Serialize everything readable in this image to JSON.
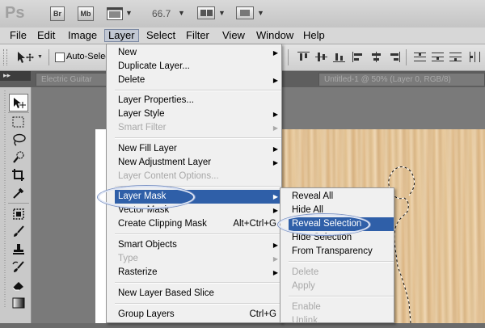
{
  "app": {
    "logo": "Ps",
    "bridge_label": "Br",
    "minibridge_label": "Mb",
    "zoom": "66.7"
  },
  "menubar": {
    "items": [
      {
        "label": "File"
      },
      {
        "label": "Edit"
      },
      {
        "label": "Image"
      },
      {
        "label": "Layer"
      },
      {
        "label": "Select"
      },
      {
        "label": "Filter"
      },
      {
        "label": "View"
      },
      {
        "label": "Window"
      },
      {
        "label": "Help"
      }
    ]
  },
  "options": {
    "auto_select_label": "Auto-Selec"
  },
  "tabs": {
    "left_tab": "Electric Guitar",
    "right_tab": "Untitled-1 @ 50% (Layer 0, RGB/8)"
  },
  "layer_menu": {
    "new": "New",
    "duplicate": "Duplicate Layer...",
    "delete": "Delete",
    "properties": "Layer Properties...",
    "style": "Layer Style",
    "smart_filter": "Smart Filter",
    "new_fill": "New Fill Layer",
    "new_adjustment": "New Adjustment Layer",
    "content_options": "Layer Content Options...",
    "layer_mask": "Layer Mask",
    "vector_mask": "Vector Mask",
    "clipping_mask": "Create Clipping Mask",
    "clipping_shortcut": "Alt+Ctrl+G",
    "smart_objects": "Smart Objects",
    "type": "Type",
    "rasterize": "Rasterize",
    "based_slice": "New Layer Based Slice",
    "group_layers": "Group Layers",
    "group_shortcut": "Ctrl+G"
  },
  "mask_submenu": {
    "reveal_all": "Reveal All",
    "hide_all": "Hide All",
    "reveal_selection": "Reveal Selection",
    "hide_selection": "Hide Selection",
    "from_transparency": "From Transparency",
    "delete": "Delete",
    "apply": "Apply",
    "enable": "Enable",
    "unlink": "Unlink"
  },
  "colors": {
    "highlight": "#2f5fa8",
    "oval": "#7c93c4"
  }
}
